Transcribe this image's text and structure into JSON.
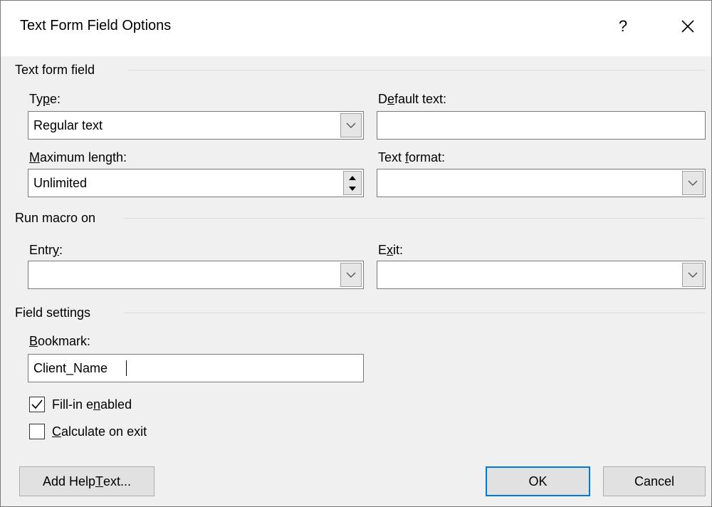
{
  "dialog": {
    "title": "Text Form Field Options",
    "help_symbol": "?",
    "close_icon": "close-icon"
  },
  "text_form_field": {
    "section_title": "Text form field",
    "type": {
      "label_before": "Ty",
      "label_mnemonic": "p",
      "label_after": "e:",
      "value": "Regular text"
    },
    "default_text": {
      "label_before": "D",
      "label_mnemonic": "e",
      "label_after": "fault text:",
      "value": ""
    },
    "maximum_length": {
      "label_before": "",
      "label_mnemonic": "M",
      "label_after": "aximum length:",
      "value": "Unlimited"
    },
    "text_format": {
      "label_before": "Text ",
      "label_mnemonic": "f",
      "label_after": "ormat:",
      "value": ""
    }
  },
  "run_macro_on": {
    "section_title": "Run macro on",
    "entry": {
      "label_before": "Entr",
      "label_mnemonic": "y",
      "label_after": ":",
      "value": ""
    },
    "exit": {
      "label_before": "E",
      "label_mnemonic": "x",
      "label_after": "it:",
      "value": ""
    }
  },
  "field_settings": {
    "section_title": "Field settings",
    "bookmark": {
      "label_before": "",
      "label_mnemonic": "B",
      "label_after": "ookmark:",
      "value": "Client_Name"
    },
    "fill_in_enabled": {
      "label_before": "Fill-in e",
      "label_mnemonic": "n",
      "label_after": "abled",
      "checked": true
    },
    "calculate_on_exit": {
      "label_before": "",
      "label_mnemonic": "C",
      "label_after": "alculate on exit",
      "checked": false
    }
  },
  "buttons": {
    "add_help_text": {
      "label_before": "Add Help ",
      "label_mnemonic": "T",
      "label_after": "ext..."
    },
    "ok": "OK",
    "cancel": "Cancel"
  },
  "colors": {
    "dialog_background": "#f0f0f0",
    "titlebar_background": "#ffffff",
    "default_button_border": "#0078d7",
    "button_background": "#e1e1e1"
  }
}
